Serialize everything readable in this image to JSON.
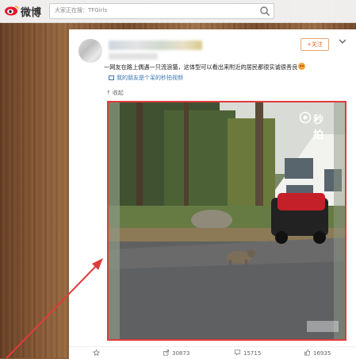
{
  "brand": {
    "name": "微博"
  },
  "search": {
    "placeholder": "大家正在搜：TFGirls"
  },
  "post": {
    "follow_label": "+关注",
    "text": "一网友在路上偶遇一只流浪猫，这体型可以看出来附近的居民都很实诚很善良",
    "video_link": "我的朋友是个呆的秒拍视频",
    "collapse_label": "收起",
    "watermark": "秒拍"
  },
  "actions": [
    {
      "icon": "star-icon",
      "label": ""
    },
    {
      "icon": "share-icon",
      "label": "30873"
    },
    {
      "icon": "comment-icon",
      "label": "15715"
    },
    {
      "icon": "like-icon",
      "label": "16935"
    }
  ],
  "colors": {
    "annotation_red": "#e03b3b",
    "follow_orange": "#e06d2a",
    "link_blue": "#3b77b0"
  }
}
